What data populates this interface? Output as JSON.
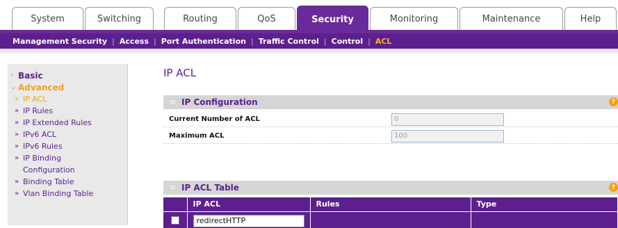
{
  "tabs": [
    {
      "label": "System"
    },
    {
      "label": "Switching"
    },
    {
      "label": "Routing"
    },
    {
      "label": "QoS"
    },
    {
      "label": "Security"
    },
    {
      "label": "Monitoring"
    },
    {
      "label": "Maintenance"
    },
    {
      "label": "Help"
    }
  ],
  "subnav": [
    {
      "label": "Management Security"
    },
    {
      "label": "Access"
    },
    {
      "label": "Port Authentication"
    },
    {
      "label": "Traffic Control"
    },
    {
      "label": "Control"
    },
    {
      "label": "ACL"
    }
  ],
  "sidebar": {
    "basic": "Basic",
    "advanced": "Advanced",
    "items": [
      {
        "label": "IP ACL"
      },
      {
        "label": "IP Rules"
      },
      {
        "label": "IP Extended Rules"
      },
      {
        "label": "IPv6 ACL"
      },
      {
        "label": "IPv6 Rules"
      },
      {
        "label": "IP Binding"
      },
      {
        "label": "Configuration"
      },
      {
        "label": "Binding Table"
      },
      {
        "label": "Vlan Binding Table"
      }
    ]
  },
  "main": {
    "title": "IP ACL",
    "ip_config": {
      "heading": "IP Configuration",
      "current_label": "Current Number of ACL",
      "current_value": "0",
      "max_label": "Maximum ACL",
      "max_value": "100"
    },
    "acl_table": {
      "heading": "IP ACL Table",
      "columns": [
        "IP ACL",
        "Rules",
        "Type"
      ],
      "input_value": "redirectHTTP"
    },
    "help_glyph": "?"
  },
  "colors": {
    "brand_purple": "#5d1f8e",
    "accent_orange": "#f2a11b"
  }
}
